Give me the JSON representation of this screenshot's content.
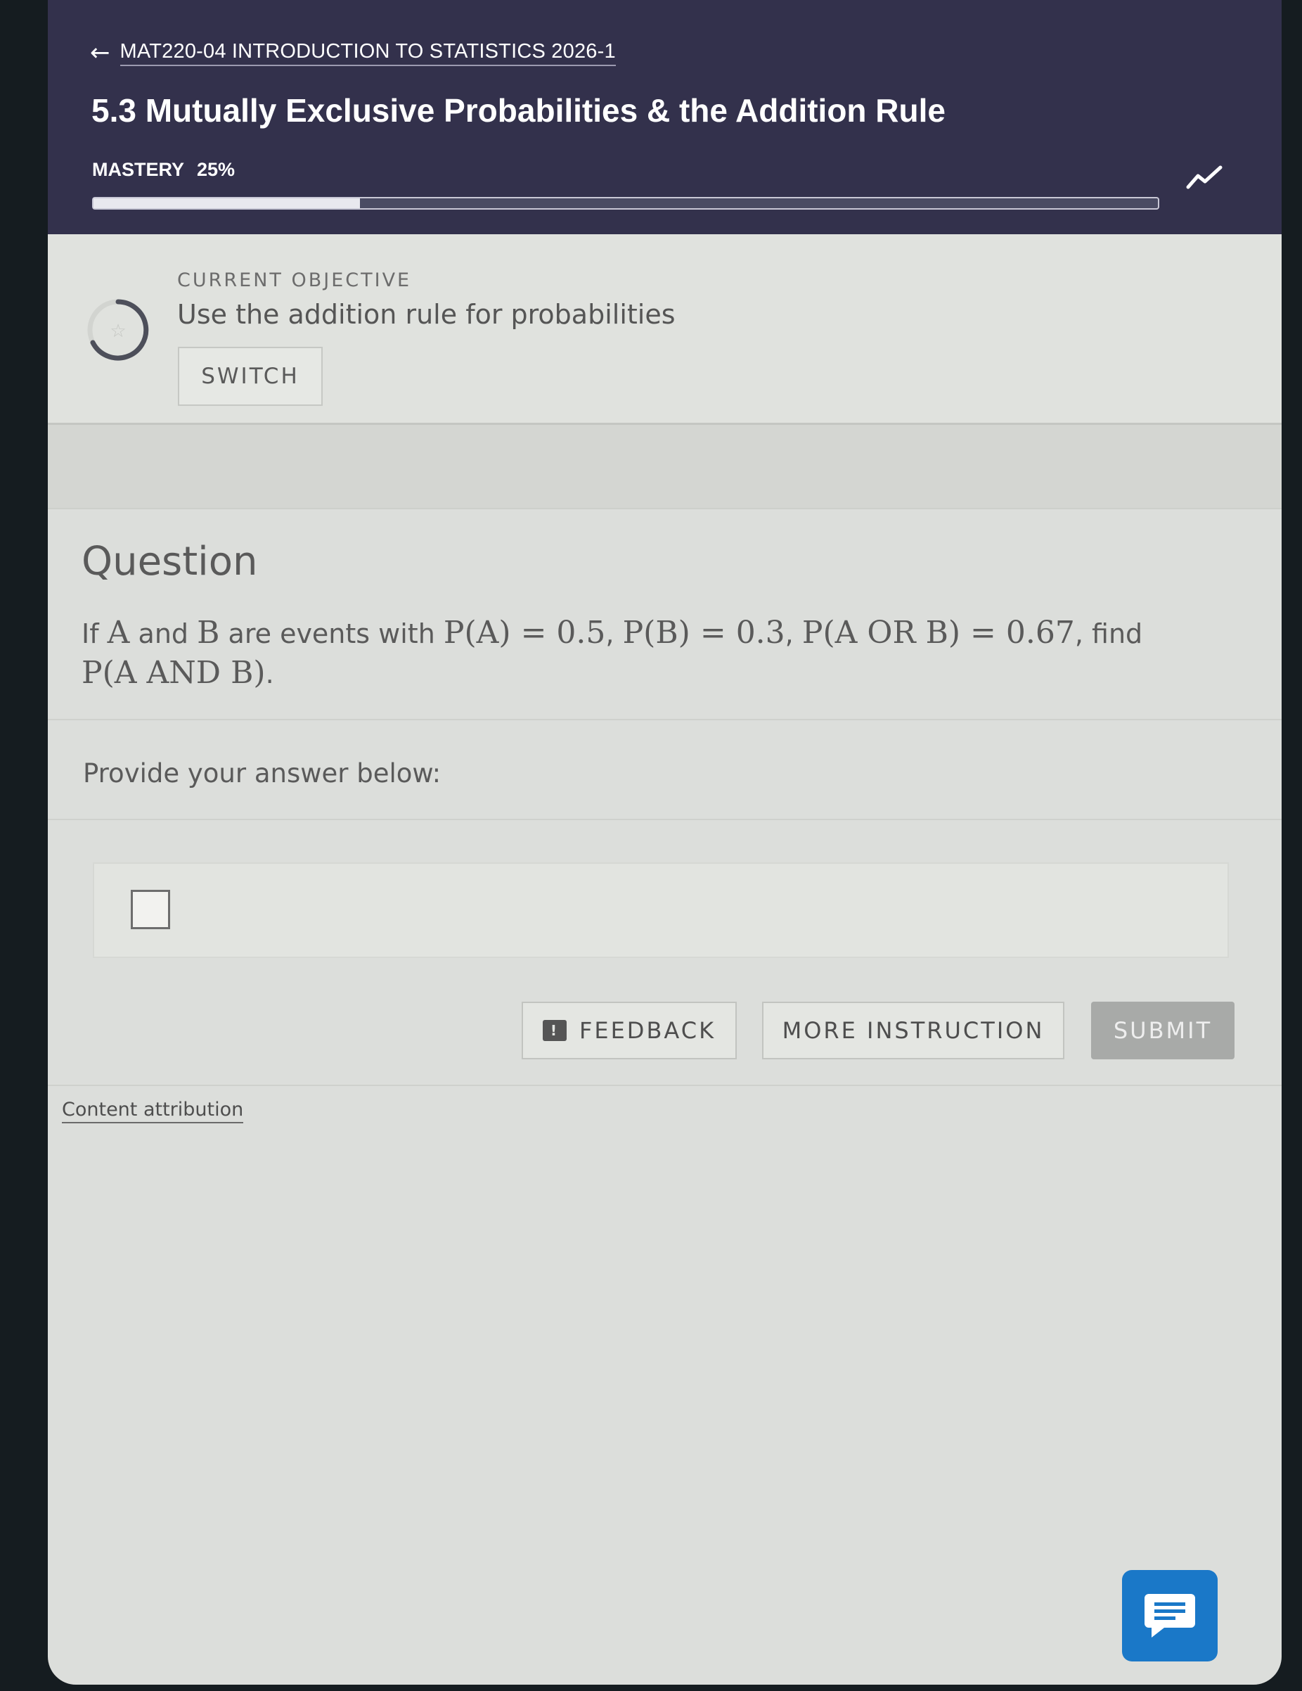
{
  "header": {
    "course_title": "MAT220-04 INTRODUCTION TO STATISTICS 2026-1",
    "page_title": "5.3 Mutually Exclusive Probabilities & the Addition Rule",
    "mastery_label": "MASTERY",
    "mastery_value": "25%",
    "mastery_fraction": 0.25
  },
  "objective": {
    "kicker": "CURRENT OBJECTIVE",
    "text": "Use the addition rule for probabilities",
    "switch_label": "SWITCH"
  },
  "question": {
    "heading": "Question",
    "t1": "If ",
    "m_a": "A",
    "t2": " and ",
    "m_b": "B",
    "t3": " are events with ",
    "m_pa": "P(A) = 0.5",
    "t4": ", ",
    "m_pb": "P(B) = 0.3",
    "t5": ", ",
    "m_por": "P(A OR B) = 0.67",
    "t6": ", find",
    "m_pand": "P(A AND B)",
    "t7": "."
  },
  "answer": {
    "prompt": "Provide your answer below:"
  },
  "actions": {
    "feedback_label": "FEEDBACK",
    "more_instruction_label": "MORE INSTRUCTION",
    "submit_label": "SUBMIT"
  },
  "footer": {
    "attribution": "Content attribution"
  },
  "icons": {
    "back": "arrow-left-icon",
    "trend": "trend-icon",
    "objective": "progress-ring-icon",
    "feedback": "feedback-icon",
    "chat": "chat-icon"
  },
  "colors": {
    "header_bg": "#33314c",
    "submit_disabled": "#a8aaa8",
    "chat_accent": "#1a78c8"
  }
}
